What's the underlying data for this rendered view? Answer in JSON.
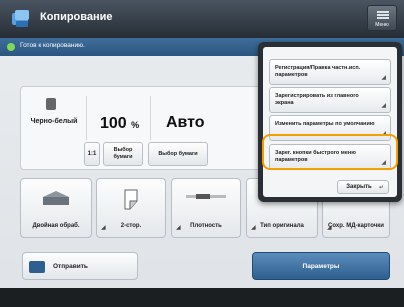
{
  "app": {
    "title": "Копирование",
    "menu_button_label": "Меню",
    "icon": "copy-app-icon"
  },
  "status": {
    "text": "Готов к копированию.",
    "indicator_color": "#7ed957"
  },
  "settings": {
    "color_mode": "Черно-белый",
    "zoom_value": "100",
    "zoom_unit": "%",
    "paper_select": "Авто",
    "ratio_button": "1:1",
    "choose_paper_button": "Выбор бумаги",
    "paper_select_button": "Выбор бумаги"
  },
  "functions": [
    {
      "label": "Двойная обраб.",
      "icon": "scanner-icon"
    },
    {
      "label": "2-стор.",
      "icon": "duplex-icon"
    },
    {
      "label": "Плотность",
      "icon": "density-icon"
    },
    {
      "label": "Тип оригинала",
      "icon": "original-type-icon"
    },
    {
      "label": "Сохр. МД-карточки",
      "icon": "card-icon"
    }
  ],
  "bottom": {
    "cancel_label": "Отправить",
    "params_label": "Параметры"
  },
  "popup": {
    "items": [
      {
        "label": "Регистрация/Правка частн.исп. параметров"
      },
      {
        "label": "Зарегистрировать из главного экрана"
      },
      {
        "label": "Изменить параметры по умолчанию"
      },
      {
        "label": "Зарег. кнопки быстрого меню параметров"
      }
    ],
    "close_label": "Закрыть",
    "highlight_color": "#f0a000"
  }
}
